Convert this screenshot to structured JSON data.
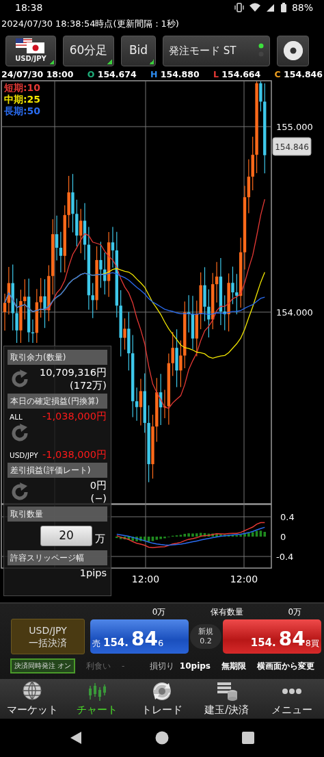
{
  "status_bar": {
    "time": "18:38",
    "battery": "88%"
  },
  "header": {
    "timestamp": "2024/07/30  18:38:54時点(更新間隔：1秒)"
  },
  "toolbar": [
    {
      "kind": "pair",
      "label": "USD/JPY"
    },
    {
      "kind": "dropdown",
      "label": "60分足"
    },
    {
      "kind": "dropdown",
      "label": "Bid"
    },
    {
      "kind": "mode",
      "label": "発注モード ST",
      "on": true
    },
    {
      "kind": "settings"
    }
  ],
  "ohlc": {
    "date": "24/07/30 18:00",
    "items": [
      {
        "letter": "O",
        "value": "154.674",
        "color": "#1fae7a"
      },
      {
        "letter": "H",
        "value": "154.880",
        "color": "#2d8cf0"
      },
      {
        "letter": "L",
        "value": "154.664",
        "color": "#e53935"
      },
      {
        "letter": "C",
        "value": "154.846",
        "color": "#f0a020"
      }
    ]
  },
  "chart": {
    "legend": [
      {
        "label": "短期:10",
        "color": "#e53935"
      },
      {
        "label": "中期:25",
        "color": "#f2e600"
      },
      {
        "label": "長期:50",
        "color": "#2a6cf0"
      }
    ],
    "price_labels": [
      "155.000",
      "154.000"
    ],
    "current_price": "154.846",
    "macd_labels": [
      "0.4",
      "0",
      "-0.4"
    ],
    "time_labels": [
      "12:00",
      "12:00"
    ]
  },
  "info_panel": [
    {
      "kind": "balance",
      "title": "取引余力(数量)",
      "values": [
        "10,709,316円",
        "(172万)"
      ]
    },
    {
      "kind": "pnl",
      "title": "本日の確定損益(円換算)",
      "rows": [
        {
          "label": "ALL",
          "value": "-1,038,000円"
        },
        {
          "label": "USD/JPY",
          "value": "-1,038,000円"
        }
      ]
    },
    {
      "kind": "balance",
      "title": "差引損益(評価レート)",
      "values": [
        "0円",
        "(−)"
      ]
    },
    {
      "kind": "quantity",
      "title": "取引数量",
      "value": "20",
      "unit": "万"
    },
    {
      "kind": "text",
      "title": "許容スリッページ幅",
      "value": "1pips"
    }
  ],
  "trade": {
    "sell_quantity": "0万",
    "holdings_label": "保有数量",
    "buy_quantity": "0万",
    "close_all": [
      "USD/JPY",
      "一括決済"
    ],
    "sell": {
      "side": "売",
      "prefix": "154.",
      "big": "84",
      "small": "6"
    },
    "order": [
      "新規",
      "0.2"
    ],
    "buy": {
      "side": "買",
      "prefix": "154.",
      "big": "84",
      "small": "8"
    },
    "settle_toggle": {
      "label": "決済同時発注 オン",
      "on": true
    },
    "take_profit": {
      "label": "利食い",
      "value": "-",
      "disabled": true
    },
    "stop_loss": {
      "label": "損切り",
      "value": "10pips"
    },
    "expiry": "無期限",
    "change_link": "横画面から変更"
  },
  "nav": [
    {
      "label": "マーケット",
      "selected": false
    },
    {
      "label": "チャート",
      "selected": true
    },
    {
      "label": "トレード",
      "selected": false
    },
    {
      "label": "建玉/決済",
      "selected": false
    },
    {
      "label": "メニュー",
      "selected": false
    }
  ]
}
